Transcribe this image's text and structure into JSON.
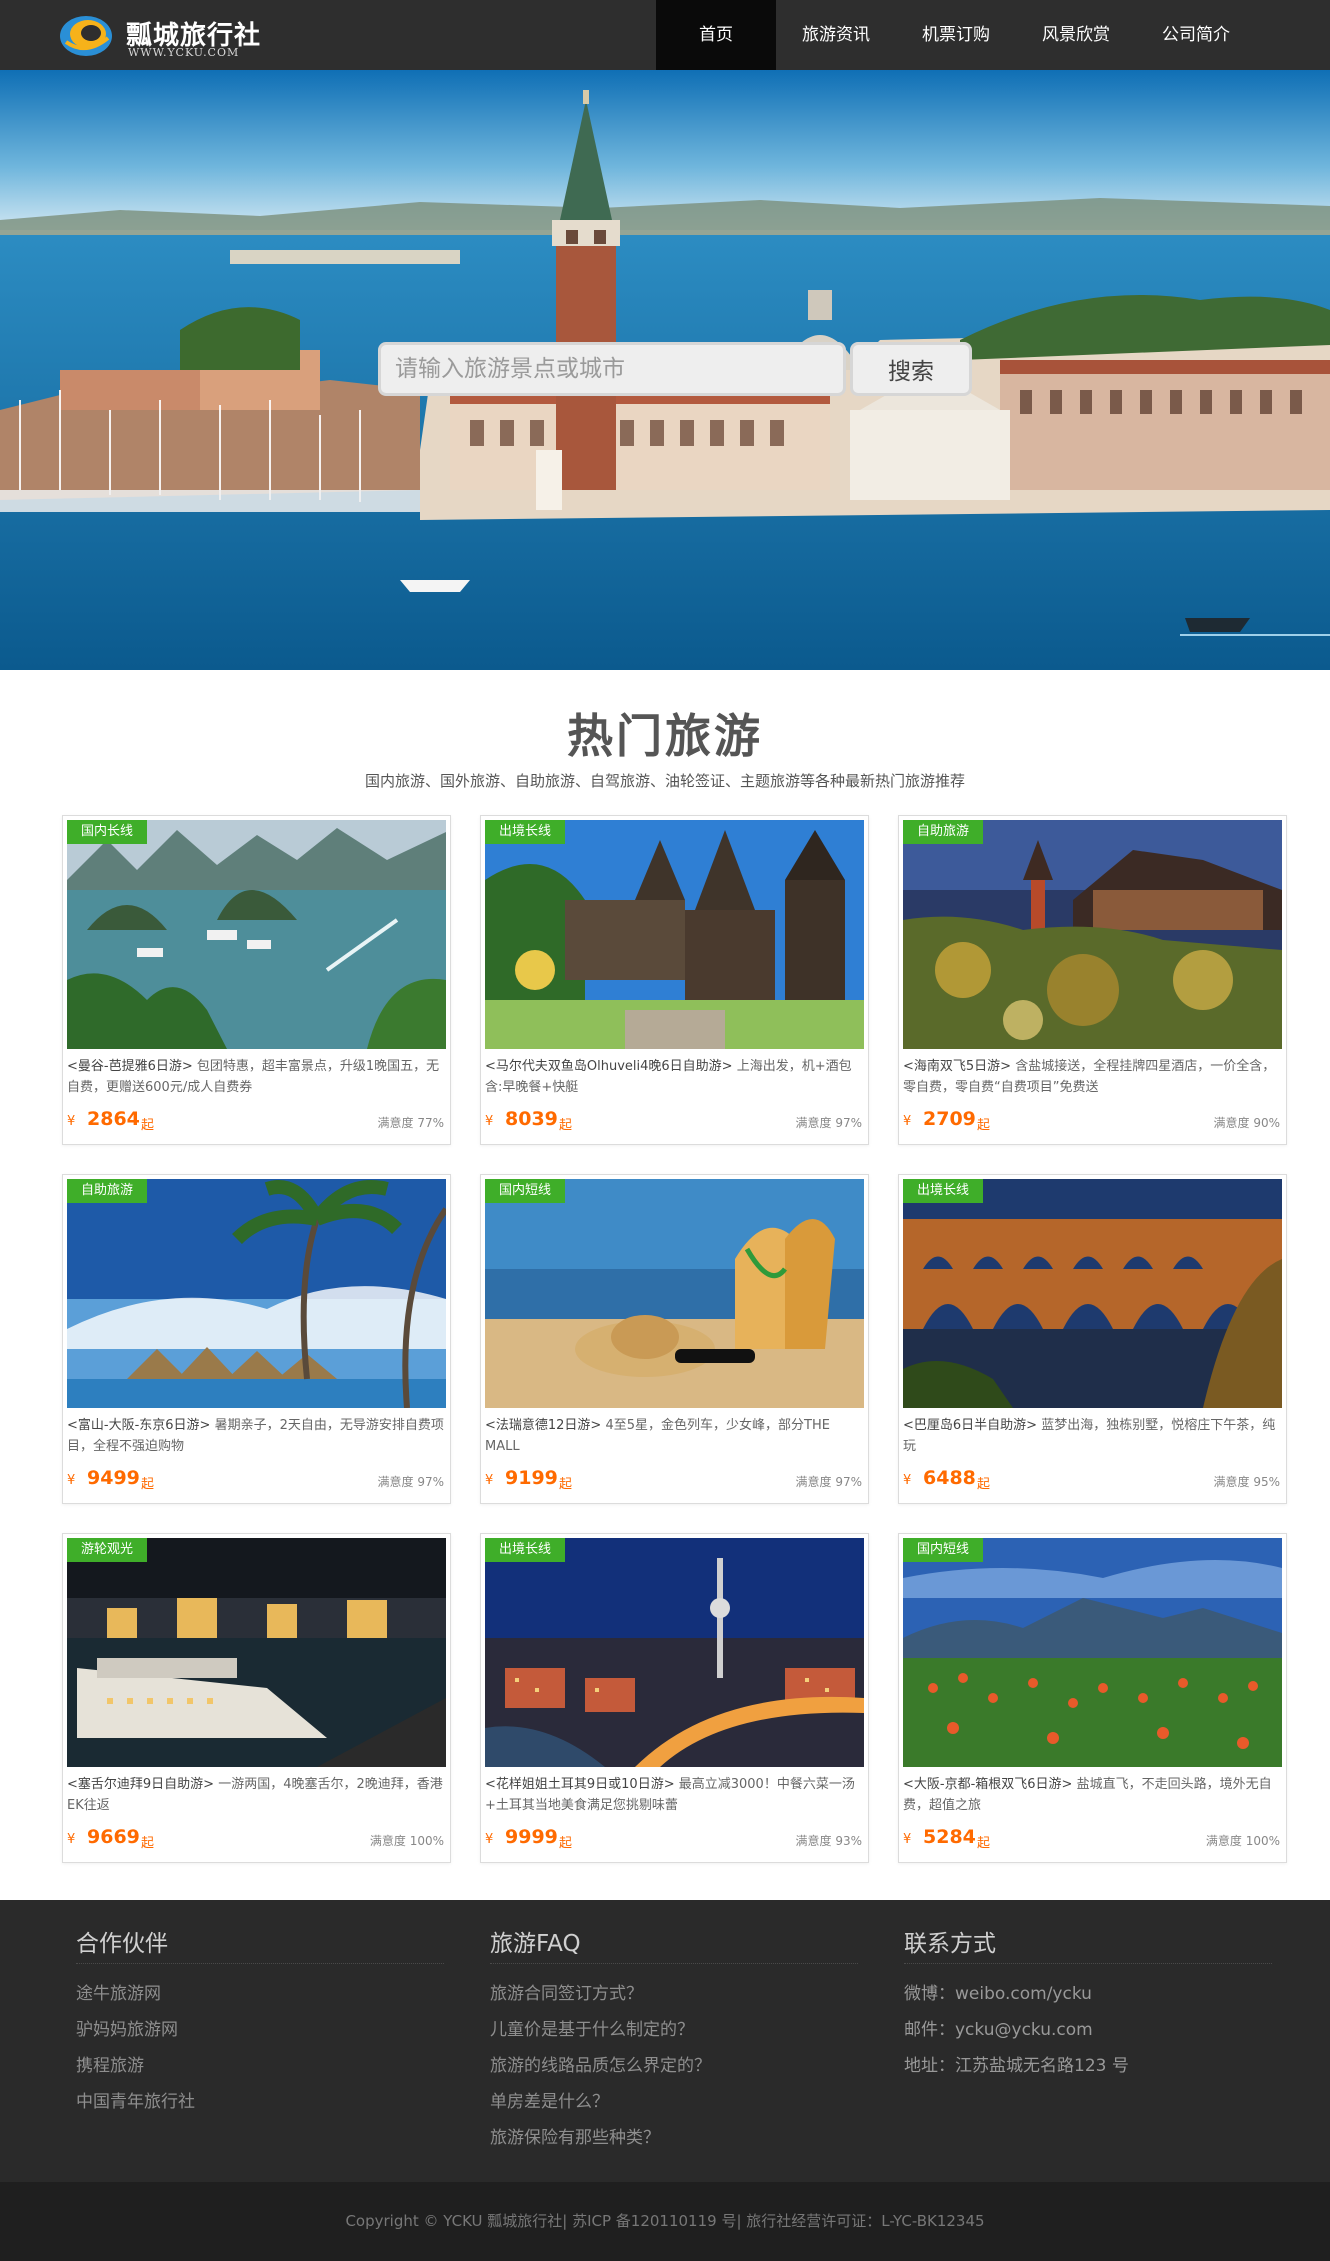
{
  "header": {
    "logo_title": "瓢城旅行社",
    "logo_sub": "WWW.YCKU.COM",
    "nav": [
      {
        "label": "首页",
        "active": true
      },
      {
        "label": "旅游资讯",
        "active": false
      },
      {
        "label": "机票订购",
        "active": false
      },
      {
        "label": "风景欣赏",
        "active": false
      },
      {
        "label": "公司简介",
        "active": false
      }
    ]
  },
  "search": {
    "placeholder": "请输入旅游景点或城市",
    "button_label": "搜索"
  },
  "hot": {
    "title": "热门旅游",
    "subtitle": "国内旅游、国外旅游、自助旅游、自驾旅游、油轮签证、主题旅游等各种最新热门旅游推荐"
  },
  "cards": [
    {
      "tag": "国内长线",
      "title": "<曼谷-芭提雅6日游>",
      "desc": " 包团特惠，超丰富景点，升级1晚国五，无自费，更赠送600元/成人自费券",
      "yen": "¥",
      "price": "2864",
      "unit": "起",
      "sat": "满意度 77%",
      "scene": "bay"
    },
    {
      "tag": "出境长线",
      "title": "<马尔代夫双鱼岛Olhuveli4晚6日自助游>",
      "desc": " 上海出发，机+酒包含:早晚餐+快艇",
      "yen": "¥",
      "price": "8039",
      "unit": "起",
      "sat": "满意度 97%",
      "scene": "temple"
    },
    {
      "tag": "自助旅游",
      "title": "<海南双飞5日游>",
      "desc": " 含盐城接送，全程挂牌四星酒店，一价全含，零自费，零自费“自费项目”免费送",
      "yen": "¥",
      "price": "2709",
      "unit": "起",
      "sat": "满意度 90%",
      "scene": "pagoda"
    },
    {
      "tag": "自助旅游",
      "title": "<富山-大阪-东京6日游>",
      "desc": " 暑期亲子，2天自由，无导游安排自费项目，全程不强迫购物",
      "yen": "¥",
      "price": "9499",
      "unit": "起",
      "sat": "满意度 97%",
      "scene": "palm"
    },
    {
      "tag": "国内短线",
      "title": "<法瑞意德12日游>",
      "desc": " 4至5星，金色列车，少女峰，部分THE MALL",
      "yen": "¥",
      "price": "9199",
      "unit": "起",
      "sat": "满意度 97%",
      "scene": "beach"
    },
    {
      "tag": "出境长线",
      "title": "<巴厘岛6日半自助游>",
      "desc": " 蓝梦出海，独栋别墅，悦榕庄下午茶，纯玩",
      "yen": "¥",
      "price": "6488",
      "unit": "起",
      "sat": "满意度 95%",
      "scene": "aqueduct"
    },
    {
      "tag": "游轮观光",
      "title": "<塞舌尔迪拜9日自助游>",
      "desc": " 一游两国，4晚塞舌尔，2晚迪拜，香港EK往返",
      "yen": "¥",
      "price": "9669",
      "unit": "起",
      "sat": "满意度 100%",
      "scene": "harbor"
    },
    {
      "tag": "出境长线",
      "title": "<花样姐姐土耳其9日或10日游>",
      "desc": " 最高立减3000！中餐六菜一汤+土耳其当地美食满足您挑剔味蕾",
      "yen": "¥",
      "price": "9999",
      "unit": "起",
      "sat": "满意度 93%",
      "scene": "city"
    },
    {
      "tag": "国内短线",
      "title": "<大阪-京都-箱根双飞6日游>",
      "desc": " 盐城直飞，不走回头路，境外无自费，超值之旅",
      "yen": "¥",
      "price": "5284",
      "unit": "起",
      "sat": "满意度 100%",
      "scene": "meadow"
    }
  ],
  "footer": {
    "partners": {
      "title": "合作伙伴",
      "items": [
        "途牛旅游网",
        "驴妈妈旅游网",
        "携程旅游",
        "中国青年旅行社"
      ]
    },
    "faq": {
      "title": "旅游FAQ",
      "items": [
        "旅游合同签订方式？",
        "儿童价是基于什么制定的？",
        "旅游的线路品质怎么界定的？",
        "单房差是什么？",
        "旅游保险有那些种类？"
      ]
    },
    "contact": {
      "title": "联系方式",
      "items": [
        "微博：weibo.com/ycku",
        "邮件：ycku@ycku.com",
        "地址：江苏盐城无名路123 号"
      ]
    },
    "copyright": "Copyright © YCKU 瓢城旅行社| 苏ICP 备120110119 号| 旅行社经营许可证：L-YC-BK12345"
  },
  "colors": {
    "header_bg": "#2e2e2e",
    "nav_active_bg": "#0a0a0a",
    "tag_green": "#3fae29",
    "price_orange": "#ff6a00",
    "footer_bg": "#2a2a2a"
  }
}
